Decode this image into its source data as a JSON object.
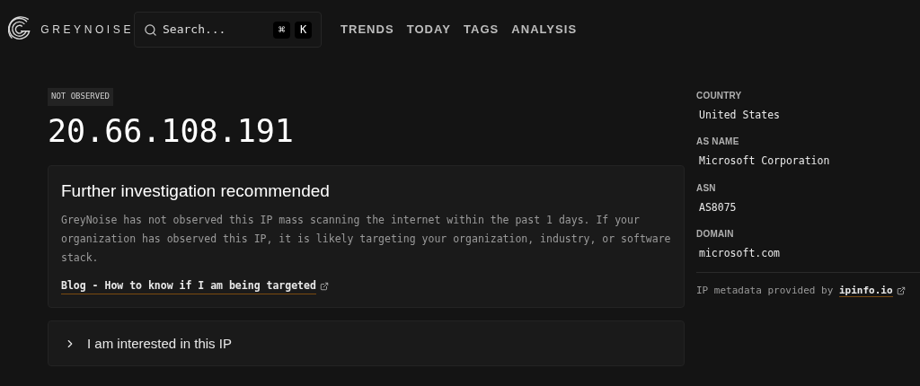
{
  "header": {
    "brand": "GREYNOISE",
    "search": {
      "placeholder": "Search...",
      "keys": [
        "⌘",
        "K"
      ]
    },
    "nav": [
      {
        "label": "TRENDS"
      },
      {
        "label": "TODAY"
      },
      {
        "label": "TAGS"
      },
      {
        "label": "ANALYSIS"
      }
    ]
  },
  "status_badge": "NOT OBSERVED",
  "ip": "20.66.108.191",
  "notice": {
    "title": "Further investigation recommended",
    "body": "GreyNoise has not observed this IP mass scanning the internet within the past 1 days. If your organization has observed this IP, it is likely targeting your organization, industry, or software stack.",
    "link": "Blog - How to know if I am being targeted"
  },
  "accordion": {
    "label": "I am interested in this IP",
    "expanded": false
  },
  "metadata": [
    {
      "label": "COUNTRY",
      "value": "United States"
    },
    {
      "label": "AS NAME",
      "value": "Microsoft Corporation"
    },
    {
      "label": "ASN",
      "value": "AS8075"
    },
    {
      "label": "DOMAIN",
      "value": "microsoft.com"
    }
  ],
  "attribution": {
    "text": "IP metadata provided by",
    "link": "ipinfo.io"
  }
}
